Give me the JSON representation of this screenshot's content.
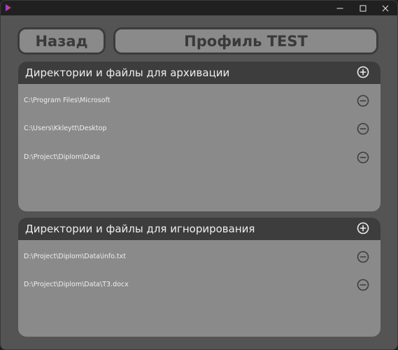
{
  "window": {
    "controls": {
      "minimize": "–",
      "maximize": "☐",
      "close": "✕"
    }
  },
  "header": {
    "back_label": "Назад",
    "profile_title": "Профиль TEST"
  },
  "archive_section": {
    "title": "Директории и файлы для архивации",
    "items": [
      {
        "path": "C:\\Program Files\\Microsoft"
      },
      {
        "path": "C:\\Users\\Kkleytt\\Desktop"
      },
      {
        "path": "D:\\Project\\Diplom\\Data"
      }
    ]
  },
  "ignore_section": {
    "title": "Директории и файлы для игнорирования",
    "items": [
      {
        "path": "D:\\Project\\Diplom\\Data\\info.txt"
      },
      {
        "path": "D:\\Project\\Diplom\\Data\\T3.docx"
      }
    ]
  },
  "colors": {
    "window_bg": "#545454",
    "panel_bg": "#8a8a8a",
    "panel_header_bg": "#3d3d3d",
    "button_border": "#3c3c3c",
    "text_light": "#eeeeee",
    "text_dark": "#3a3a3a"
  },
  "icons": {
    "app": "app-logo-icon",
    "add": "plus-circle-icon",
    "remove": "minus-circle-icon"
  }
}
